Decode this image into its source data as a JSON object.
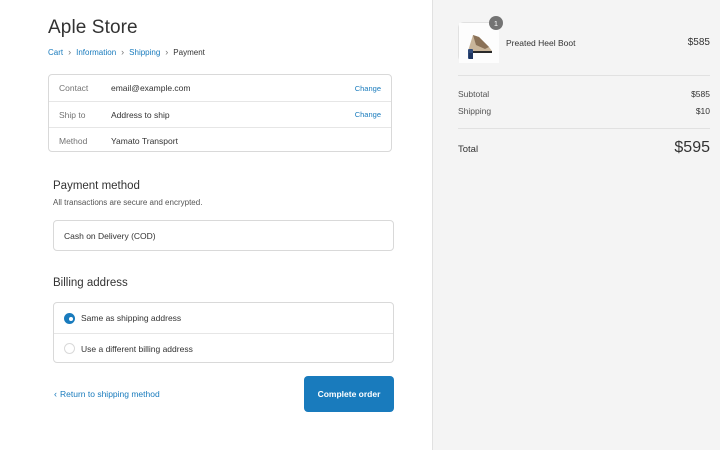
{
  "store": {
    "title": "Aple Store"
  },
  "breadcrumb": {
    "items": [
      "Cart",
      "Information",
      "Shipping",
      "Payment"
    ],
    "separator": "›"
  },
  "review": {
    "rows": [
      {
        "label": "Contact",
        "value": "email@example.com",
        "action": "Change"
      },
      {
        "label": "Ship to",
        "value": "Address to ship",
        "action": "Change"
      },
      {
        "label": "Method",
        "value": "Yamato Transport"
      }
    ]
  },
  "payment": {
    "title": "Payment method",
    "subtitle": "All transactions are secure and encrypted.",
    "option": "Cash on Delivery (COD)"
  },
  "billing": {
    "title": "Billing address",
    "options": [
      {
        "label": "Same as shipping address",
        "selected": true
      },
      {
        "label": "Use a different billing address",
        "selected": false
      }
    ]
  },
  "footer": {
    "return_label": "Return to shipping method",
    "complete_label": "Complete order"
  },
  "summary": {
    "product": {
      "name": "Preated Heel Boot",
      "price": "$585",
      "quantity": "1"
    },
    "subtotal_label": "Subtotal",
    "subtotal_value": "$585",
    "shipping_label": "Shipping",
    "shipping_value": "$10",
    "total_label": "Total",
    "total_value": "$595"
  },
  "colors": {
    "accent": "#197bbd",
    "sidebar_bg": "#f4f4f4",
    "text": "#333333",
    "muted": "#737373"
  }
}
